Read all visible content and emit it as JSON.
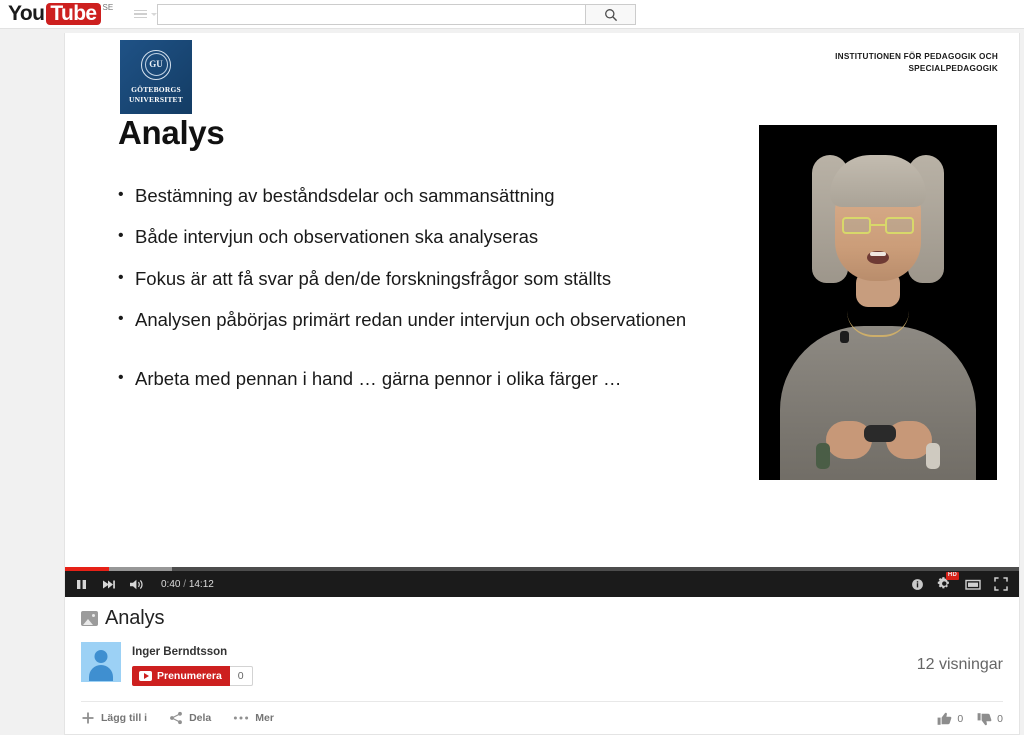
{
  "masthead": {
    "logo_you": "You",
    "logo_tube": "Tube",
    "country_code": "SE",
    "guide_icon": "hamburger-menu-icon",
    "search_placeholder": "",
    "search_value": "",
    "search_icon": "search-icon"
  },
  "slide": {
    "university": {
      "seal_text": "GU",
      "name_line1": "GÖTEBORGS",
      "name_line2": "UNIVERSITET"
    },
    "department_line1": "INSTITUTIONEN FÖR PEDAGOGIK OCH",
    "department_line2": "SPECIALPEDAGOGIK",
    "title": "Analys",
    "bullet_char": "•",
    "bullets": [
      {
        "text": "Bestämning av beståndsdelar och sammansättning",
        "gap_above": false
      },
      {
        "text": "Både intervjun och observationen ska analyseras",
        "gap_above": false
      },
      {
        "text": "Fokus är att få svar på den/de forskningsfrågor som ställts",
        "gap_above": false
      },
      {
        "text": "Analysen påbörjas primärt redan under intervjun och observationen",
        "gap_above": false
      },
      {
        "text": "Arbeta med pennan i hand … gärna pennor i olika färger …",
        "gap_above": true
      }
    ]
  },
  "player": {
    "progress_played_pct": "4.6%",
    "progress_loaded_pct": "11.2%",
    "progress_color": "#e62117",
    "pause_icon": "pause-icon",
    "next_icon": "next-video-icon",
    "volume_icon": "volume-icon",
    "current_time": "0:40",
    "time_separator": " / ",
    "total_time": "14:12",
    "info_icon": "info-card-icon",
    "settings_icon": "settings-gear-icon",
    "hd_badge": "HD",
    "theater_icon": "theater-mode-icon",
    "fullscreen_icon": "fullscreen-icon"
  },
  "meta": {
    "title_icon": "photo-slide-icon",
    "title": "Analys",
    "avatar_icon": "default-user-avatar",
    "channel_name": "Inger Berndtsson",
    "subscribe_label": "Prenumerera",
    "subscriber_count": "0",
    "view_count": "12 visningar"
  },
  "actions": {
    "add_to": {
      "label": "Lägg till i",
      "icon": "plus-icon"
    },
    "share": {
      "label": "Dela",
      "icon": "share-icon"
    },
    "more": {
      "label": "Mer",
      "icon": "more-dots-icon"
    },
    "like": {
      "count": "0",
      "icon": "thumbs-up-icon"
    },
    "dislike": {
      "count": "0",
      "icon": "thumbs-down-icon"
    }
  }
}
